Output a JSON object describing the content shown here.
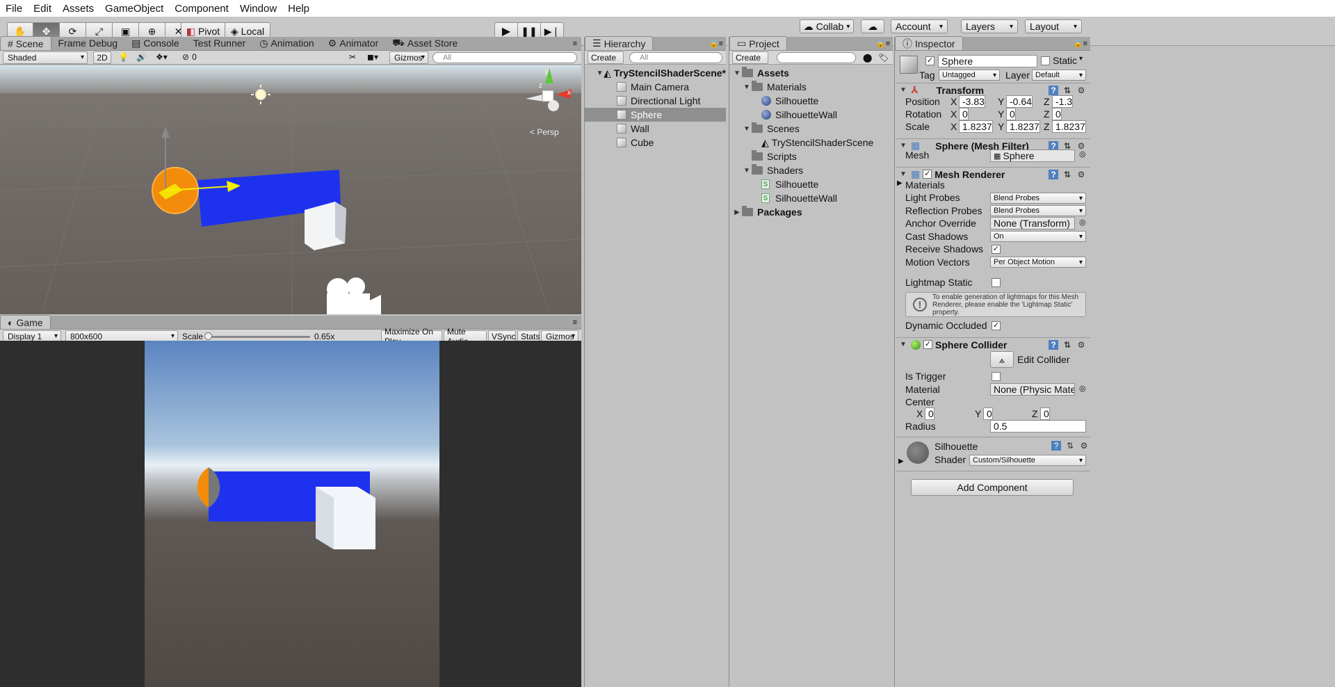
{
  "menu": [
    "File",
    "Edit",
    "Assets",
    "GameObject",
    "Component",
    "Window",
    "Help"
  ],
  "toolbar": {
    "pivot": "Pivot",
    "local": "Local",
    "collab": "Collab",
    "account": "Account",
    "layers": "Layers",
    "layout": "Layout"
  },
  "scene_tabs": [
    "Scene",
    "Frame Debug",
    "Console",
    "Test Runner",
    "Animation",
    "Animator",
    "Asset Store"
  ],
  "scene_strip": {
    "shading": "Shaded",
    "mode2d": "2D",
    "hidden_count": "0",
    "gizmos": "Gizmos",
    "search_placeholder": "All"
  },
  "scene_view": {
    "persp_label": "< Persp",
    "gizmo_x": "x",
    "gizmo_y": "y",
    "gizmo_z": "z"
  },
  "game": {
    "tab": "Game",
    "display": "Display 1",
    "resolution": "800x600",
    "scale_label": "Scale",
    "scale_value": "0.65x",
    "scale_fraction": 0.02,
    "maximize": "Maximize On Play",
    "mute": "Mute Audio",
    "vsync": "VSync",
    "stats": "Stats",
    "gizmos": "Gizmos"
  },
  "hierarchy": {
    "tab": "Hierarchy",
    "create": "Create",
    "search_placeholder": "All",
    "scene": "TryStencilShaderScene*",
    "items": [
      "Main Camera",
      "Directional Light",
      "Sphere",
      "Wall",
      "Cube"
    ],
    "selected": "Sphere"
  },
  "project": {
    "tab": "Project",
    "create": "Create",
    "assets": "Assets",
    "materials": "Materials",
    "mat_items": [
      "Silhouette",
      "SilhouetteWall"
    ],
    "scenes": "Scenes",
    "scene_items": [
      "TryStencilShaderScene"
    ],
    "scripts": "Scripts",
    "shaders": "Shaders",
    "shader_items": [
      "Silhouette",
      "SilhouetteWall"
    ],
    "packages": "Packages"
  },
  "inspector": {
    "tab": "Inspector",
    "name": "Sphere",
    "static_label": "Static",
    "tag_label": "Tag",
    "tag_value": "Untagged",
    "layer_label": "Layer",
    "layer_value": "Default",
    "transform": {
      "title": "Transform",
      "position_label": "Position",
      "rotation_label": "Rotation",
      "scale_label": "Scale",
      "position": [
        "-3.83",
        "-0.64",
        "-1.3"
      ],
      "rotation": [
        "0",
        "0",
        "0"
      ],
      "scale": [
        "1.8237",
        "1.8237",
        "1.8237"
      ]
    },
    "axis": [
      "X",
      "Y",
      "Z"
    ],
    "mesh_filter": {
      "title": "Sphere (Mesh Filter)",
      "mesh_label": "Mesh",
      "mesh_value": "Sphere"
    },
    "mesh_renderer": {
      "title": "Mesh Renderer",
      "materials": "Materials",
      "light_probes": "Light Probes",
      "light_probes_value": "Blend Probes",
      "reflection_probes": "Reflection Probes",
      "reflection_probes_value": "Blend Probes",
      "anchor_override": "Anchor Override",
      "anchor_override_value": "None (Transform)",
      "cast_shadows": "Cast Shadows",
      "cast_shadows_value": "On",
      "receive_shadows": "Receive Shadows",
      "motion_vectors": "Motion Vectors",
      "motion_vectors_value": "Per Object Motion",
      "lightmap_static": "Lightmap Static",
      "info": "To enable generation of lightmaps for this Mesh Renderer, please enable the 'Lightmap Static' property.",
      "dynamic_occluded": "Dynamic Occluded"
    },
    "sphere_collider": {
      "title": "Sphere Collider",
      "edit_collider": "Edit Collider",
      "is_trigger": "Is Trigger",
      "material": "Material",
      "material_value": "None (Physic Materia",
      "center": "Center",
      "center_values": [
        "0",
        "0",
        "0"
      ],
      "radius": "Radius",
      "radius_value": "0.5"
    },
    "material": {
      "name": "Silhouette",
      "shader_label": "Shader",
      "shader_value": "Custom/Silhouette"
    },
    "add_component": "Add Component"
  }
}
